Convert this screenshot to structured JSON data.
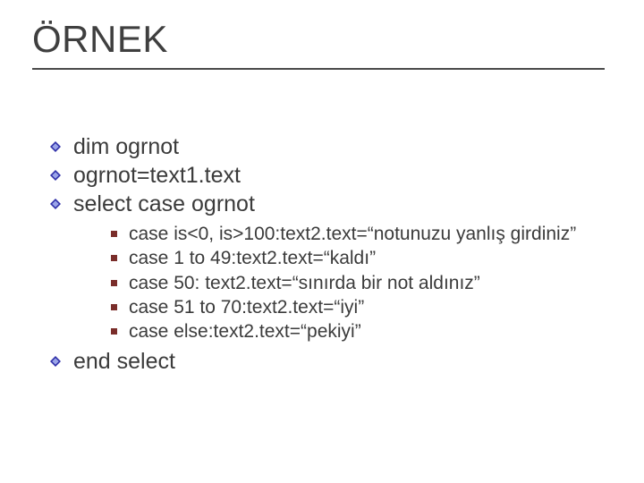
{
  "title": "ÖRNEK",
  "bullets": {
    "b1": "dim ogrnot",
    "b2": "ogrnot=text1.text",
    "b3": "select case ogrnot",
    "b4": "end select"
  },
  "sub": {
    "s1": "case is<0, is>100:text2.text=“notunuzu yanlış girdiniz”",
    "s2": "case 1 to 49:text2.text=“kaldı”",
    "s3": "case 50: text2.text=“sınırda bir not aldınız”",
    "s4": "case 51 to 70:text2.text=“iyi”",
    "s5": "case else:text2.text=“pekiyi”"
  }
}
